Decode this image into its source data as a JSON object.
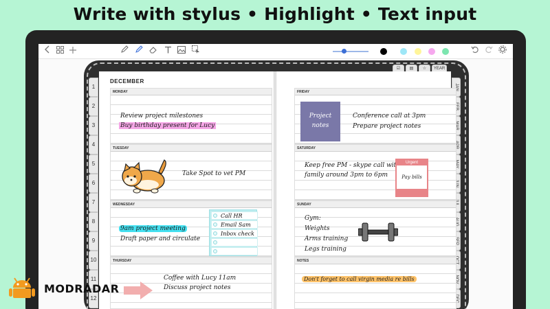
{
  "headline": "Write with stylus  •  Highlight  •  Text input",
  "toolbar": {
    "icons": [
      "chevron-left-icon",
      "grid-icon",
      "plus-icon",
      "pencil-icon",
      "pen-icon",
      "eraser-icon",
      "text-icon",
      "image-icon",
      "lasso-select-icon",
      "undo-icon",
      "redo-icon",
      "settings-icon"
    ],
    "colors": [
      "#000000",
      "#9ee7f7",
      "#fff59a",
      "#f6a8ee",
      "#7de6b0"
    ]
  },
  "planner": {
    "month": "DECEMBER",
    "left_tabs": [
      "1",
      "2",
      "3",
      "4",
      "5",
      "6",
      "7",
      "8",
      "9",
      "10",
      "11",
      "12"
    ],
    "month_tabs": [
      "JAN",
      "FEB",
      "MAR",
      "APR",
      "MAY",
      "JUN",
      "JUL",
      "AUG",
      "SEP",
      "OCT",
      "NOV",
      "DEC"
    ],
    "top_tabs": [
      "checklist-icon",
      "notes-icon",
      "star-icon"
    ],
    "year_tab": "YEAR",
    "monday": {
      "label": "MONDAY",
      "lines": [
        "Review project milestones",
        "Buy birthday present for Lucy"
      ]
    },
    "tuesday": {
      "label": "TUESDAY",
      "lines": [
        "Take Spot to vet PM"
      ]
    },
    "wednesday": {
      "label": "WEDNESDAY",
      "lines": [
        "9am project meeting",
        "Draft paper and circulate"
      ],
      "checklist": [
        "Call HR",
        "Email Sam",
        "Inbox check"
      ]
    },
    "thursday": {
      "label": "THURSDAY",
      "lines": [
        "Coffee with Lucy 11am",
        "Discuss project notes"
      ]
    },
    "friday": {
      "label": "FRIDAY",
      "sticky": "Project notes",
      "lines": [
        "Conference call at 3pm",
        "Prepare project notes"
      ]
    },
    "saturday": {
      "label": "SATURDAY",
      "lines": [
        "Keep free PM - skype call with",
        "family around 3pm to 6pm"
      ],
      "urgent_title": "Urgent",
      "urgent_body": "Pay bills"
    },
    "sunday": {
      "label": "SUNDAY",
      "lines": [
        "Gym:",
        "Weights",
        "Arms training",
        "Legs training"
      ]
    },
    "notes": {
      "label": "NOTES",
      "lines": [
        "Don't forget to call virgin media re bills"
      ]
    }
  },
  "branding": {
    "logo_text": "MODRADAR"
  }
}
